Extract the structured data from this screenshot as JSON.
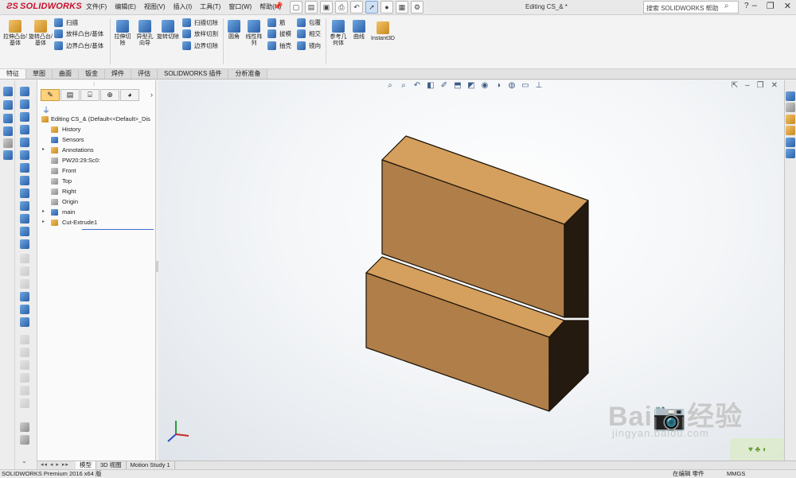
{
  "app": {
    "logo_text": "SOLIDWORKS",
    "document_title": "Editing CS_& *",
    "search_placeholder": "搜索 SOLIDWORKS 帮助"
  },
  "menu": [
    "文件(F)",
    "编辑(E)",
    "视图(V)",
    "插入(I)",
    "工具(T)",
    "窗口(W)",
    "帮助(H)"
  ],
  "ribbon": {
    "extrude_boss": "拉伸凸台/基体",
    "revolve_boss": "旋转凸台/基体",
    "sweep": "扫描",
    "loft": "放样凸台/基体",
    "boundary_boss": "边界凸台/基体",
    "extrude_cut": "拉伸切除",
    "hole_wizard": "异型孔向导",
    "revolve_cut": "旋转切除",
    "swept_cut": "扫描切除",
    "lofted_cut": "放样切割",
    "boundary_cut": "边界切除",
    "fillet": "圆角",
    "linear_pattern": "线性阵列",
    "rib": "筋",
    "draft": "拔模",
    "shell": "抽壳",
    "wrap": "包覆",
    "intersect": "相交",
    "mirror": "镜向",
    "ref_geometry": "参考几何体",
    "curves": "曲线",
    "instant3d": "Instant3D"
  },
  "tabs": [
    "特征",
    "草图",
    "曲面",
    "钣金",
    "焊件",
    "评估",
    "SOLIDWORKS 插件",
    "分析准备"
  ],
  "feature_tree": {
    "root": "Editing CS_&  (Default<<Default>_Dis",
    "items": [
      {
        "label": "History",
        "expand": ""
      },
      {
        "label": "Sensors",
        "expand": ""
      },
      {
        "label": "Annotations",
        "expand": "▸"
      },
      {
        "label": "PW20:29:Sc0:",
        "expand": ""
      },
      {
        "label": "Front",
        "expand": ""
      },
      {
        "label": "Top",
        "expand": ""
      },
      {
        "label": "Right",
        "expand": ""
      },
      {
        "label": "Origin",
        "expand": ""
      },
      {
        "label": "main",
        "expand": "▸"
      },
      {
        "label": "Cut-Extrude1",
        "expand": "▸"
      }
    ]
  },
  "bottom_tabs": [
    "模型",
    "3D 视图",
    "Motion Study 1"
  ],
  "bottom_arrows": "◂◂ ◂ ▸ ▸▸",
  "status": {
    "left": "SOLIDWORKS Premium 2016 x64 版",
    "mode": "在编辑 零件",
    "units": "MMGS"
  },
  "watermark": {
    "text": "Bai📷经验",
    "url": "jingyan.baidu.com"
  },
  "colors": {
    "part_top": "#d59f5d",
    "part_front": "#b07e48",
    "part_side": "#241a10",
    "brand_red": "#c8102e"
  }
}
